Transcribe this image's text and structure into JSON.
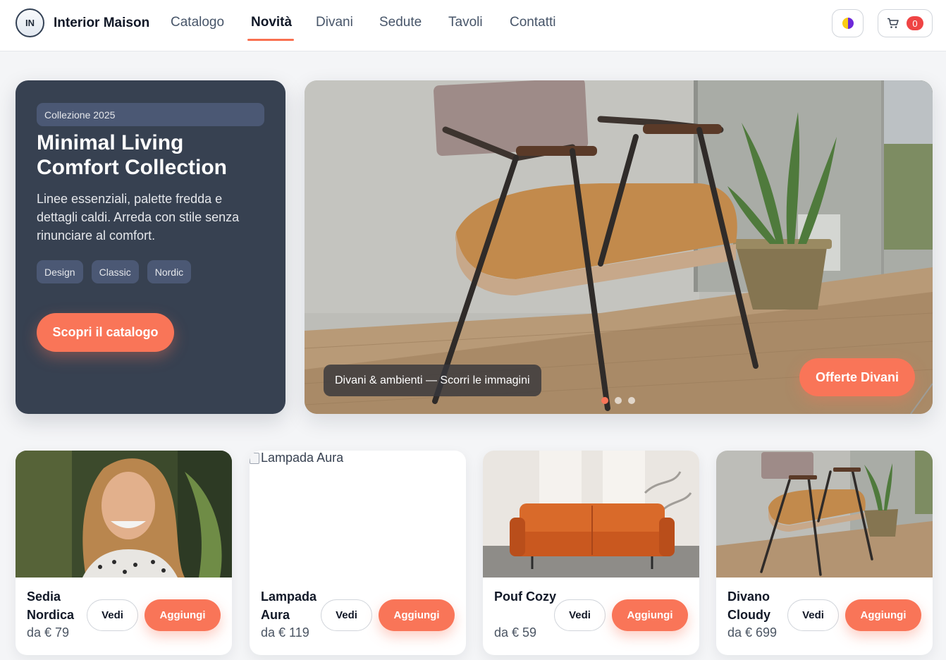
{
  "header": {
    "logo_initials": "IN",
    "brand": "Interior Maison",
    "nav": [
      "Catalogo",
      "Novità",
      "Divani",
      "Sedute",
      "Tavoli",
      "Contatti"
    ],
    "active_nav": "Novità",
    "cart_count": "0"
  },
  "hero": {
    "badge": "Collezione 2025",
    "title_line1": "Minimal Living",
    "title_line2": "Comfort Collection",
    "description": "Linee essenziali, palette fredda e dettagli caldi. Arreda con stile senza rinunciare al comfort.",
    "tags": [
      "Design",
      "Classic",
      "Nordic"
    ],
    "cta": "Scopri il catalogo"
  },
  "carousel": {
    "caption": "Divani & ambienti — Scorri le immagini",
    "offer_button": "Offerte Divani",
    "active_slide": 1,
    "slide_count": 3
  },
  "products": [
    {
      "name": "Sedia Nordica",
      "price": "da € 79",
      "view": "Vedi",
      "add": "Aggiungi",
      "image": "woman-portrait"
    },
    {
      "name": "Lampada Aura",
      "price": "da € 119",
      "view": "Vedi",
      "add": "Aggiungi",
      "image": "broken",
      "alt": "Lampada Aura"
    },
    {
      "name": "Pouf Cozy",
      "price": "da € 59",
      "view": "Vedi",
      "add": "Aggiungi",
      "image": "orange-sofa"
    },
    {
      "name": "Divano Cloudy",
      "price": "da € 699",
      "view": "Vedi",
      "add": "Aggiungi",
      "image": "armchair"
    }
  ],
  "colors": {
    "accent": "#f97558",
    "hero_card": "#374151",
    "badge_bg": "#4b5874",
    "cart_badge": "#ef4444"
  }
}
